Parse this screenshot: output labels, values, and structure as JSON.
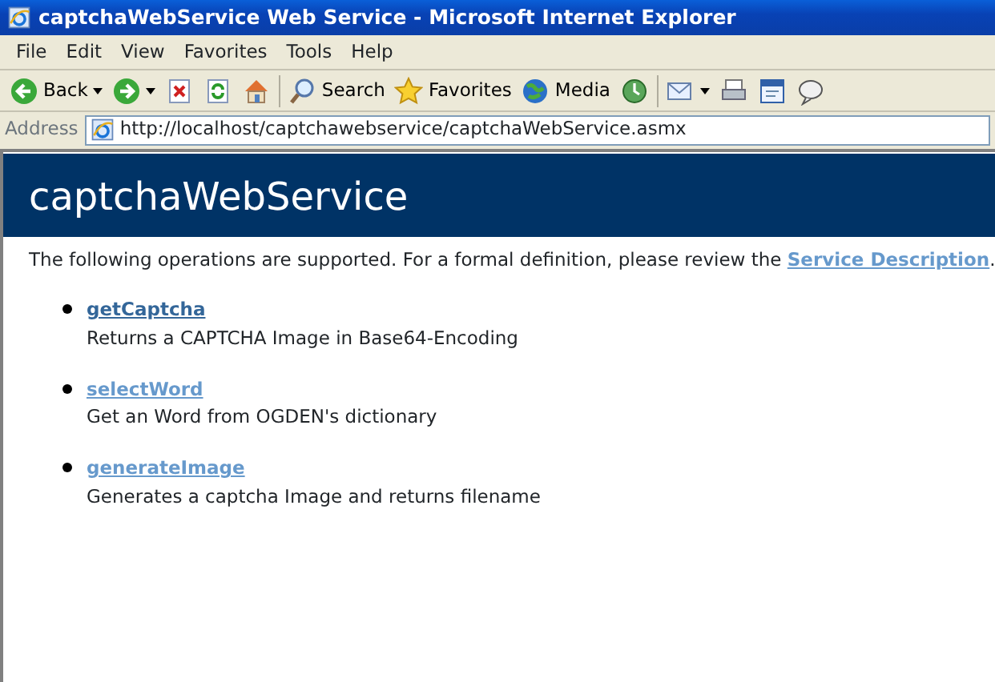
{
  "window": {
    "title": "captchaWebService Web Service - Microsoft Internet Explorer"
  },
  "menu": [
    "File",
    "Edit",
    "View",
    "Favorites",
    "Tools",
    "Help"
  ],
  "toolbar": [
    {
      "kind": "back",
      "label": "Back"
    },
    {
      "kind": "forward"
    },
    {
      "kind": "stop"
    },
    {
      "kind": "refresh"
    },
    {
      "kind": "home"
    },
    {
      "kind": "search",
      "label": "Search"
    },
    {
      "kind": "favorites",
      "label": "Favorites"
    },
    {
      "kind": "media",
      "label": "Media"
    },
    {
      "kind": "history"
    },
    {
      "kind": "mail"
    },
    {
      "kind": "print"
    },
    {
      "kind": "edit"
    },
    {
      "kind": "discuss"
    }
  ],
  "address": {
    "label": "Address",
    "value": "http://localhost/captchawebservice/captchaWebService.asmx"
  },
  "page": {
    "heading": "captchaWebService",
    "intro": "The following operations are supported. For a formal definition, please review the",
    "intro_link": "Service Description",
    "intro_end": ".",
    "operations": [
      {
        "name": "getCaptcha",
        "visited": true,
        "description": "Returns a CAPTCHA Image in Base64-Encoding"
      },
      {
        "name": "selectWord",
        "visited": false,
        "description": "Get an Word from OGDEN's dictionary"
      },
      {
        "name": "generateImage",
        "visited": false,
        "description": "Generates a captcha Image and returns filename"
      }
    ]
  }
}
